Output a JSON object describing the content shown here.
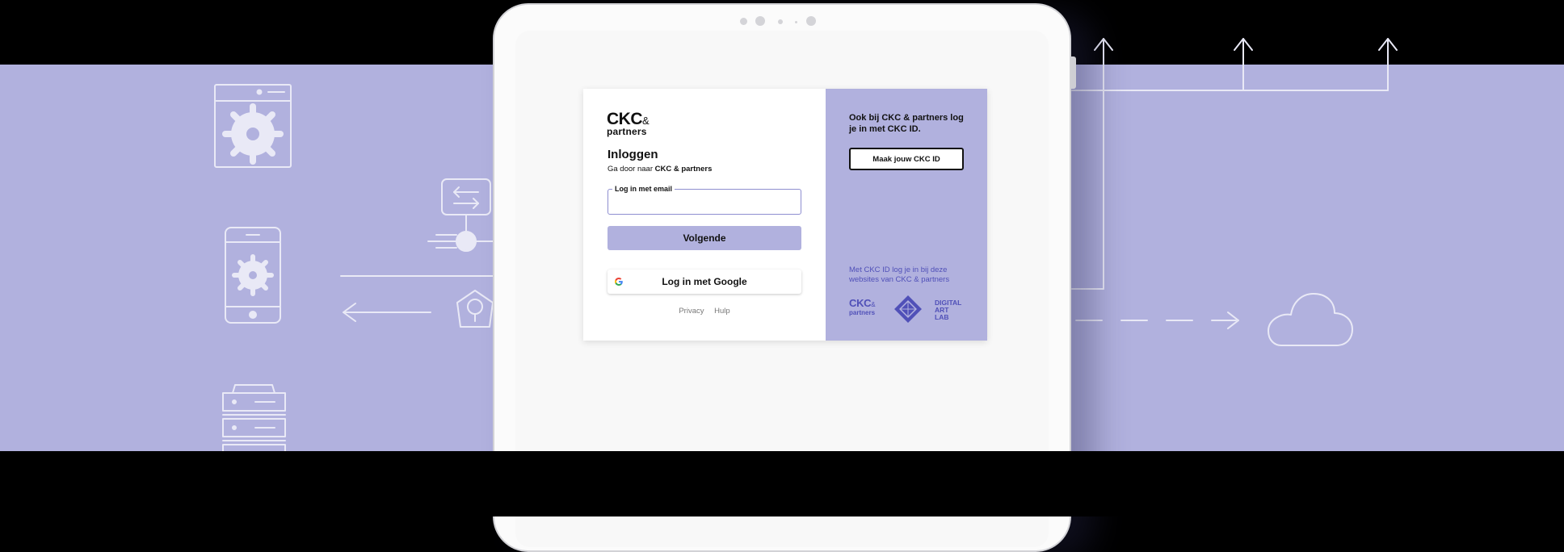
{
  "login": {
    "logo_main": "CKC",
    "logo_amp": "&",
    "logo_sub": "partners",
    "title": "Inloggen",
    "subtitle_prefix": "Ga door naar ",
    "subtitle_brand": "CKC & partners",
    "email_label": "Log in met email",
    "email_value": "",
    "next_button": "Volgende",
    "google_button": "Log in met Google",
    "privacy_link": "Privacy",
    "help_link": "Hulp"
  },
  "side": {
    "heading": "Ook bij CKC & partners log je in met CKC ID.",
    "create_button": "Maak jouw CKC ID",
    "info": "Met CKC ID log je in bij deze websites van CKC & partners",
    "logo1_main": "CKC",
    "logo1_amp": "&",
    "logo1_sub": "partners",
    "logo2_line1": "DIGITAL",
    "logo2_line2": "ART",
    "logo2_line3": "LAB"
  },
  "colors": {
    "accent": "#b1b1de",
    "accent_text": "#5050b8",
    "background": "#000000"
  },
  "icons": [
    "settings-window-icon",
    "phone-settings-icon",
    "server-stack-icon",
    "network-switch-icon",
    "key-shield-icon",
    "cloud-icon",
    "arrow-left-icon",
    "arrow-up-icon",
    "google-icon"
  ]
}
